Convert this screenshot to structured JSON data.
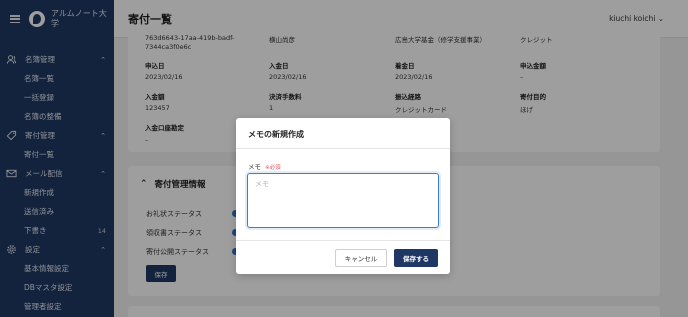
{
  "sidebar": {
    "org_name": "アルムノート大学",
    "items": [
      {
        "label": "名簿管理",
        "section": true,
        "icon": "users-icon",
        "chevron": "^"
      },
      {
        "label": "名簿一覧"
      },
      {
        "label": "一括登録"
      },
      {
        "label": "名簿の整備"
      },
      {
        "label": "寄付管理",
        "section": true,
        "icon": "tag-icon",
        "chevron": "^"
      },
      {
        "label": "寄付一覧"
      },
      {
        "label": "メール配信",
        "section": true,
        "icon": "mail-icon",
        "chevron": "^"
      },
      {
        "label": "新規作成"
      },
      {
        "label": "送信済み"
      },
      {
        "label": "下書き",
        "count": "14"
      },
      {
        "label": "設定",
        "section": true,
        "icon": "gear-icon",
        "chevron": "^"
      },
      {
        "label": "基本情報設定"
      },
      {
        "label": "DBマスタ設定"
      },
      {
        "label": "管理者設定"
      }
    ]
  },
  "header": {
    "title": "寄付一覧",
    "user": "kiuchi koichi"
  },
  "detail": {
    "row0": {
      "id": "763d6643-17aa-419b-badf-7344ca3f0e6c",
      "name": "横山尚彦",
      "fund": "広島大学基金（修学支援事業）",
      "method": "クレジット"
    },
    "row1_labels": {
      "a": "申込日",
      "b": "入金日",
      "c": "着金日",
      "d": "申込金額"
    },
    "row1_values": {
      "a": "2023/02/16",
      "b": "2023/02/16",
      "c": "2023/02/16",
      "d": "–"
    },
    "row2_labels": {
      "a": "入金額",
      "b": "決済手数料",
      "c": "振込経路",
      "d": "寄付目的"
    },
    "row2_values": {
      "a": "123457",
      "b": "1",
      "c": "クレジットカード",
      "d": "ほげ"
    },
    "row3_label": "入金口座勘定",
    "row3_value": "–"
  },
  "donation_mgmt": {
    "title": "寄付管理情報",
    "rows": [
      "お礼状ステータス",
      "領収書ステータス",
      "寄付公開ステータス"
    ],
    "save_label": "保存"
  },
  "modal": {
    "title": "メモの新規作成",
    "field_label": "メモ",
    "required": "※必須",
    "placeholder": "メモ",
    "cancel_label": "キャンセル",
    "save_label": "保存する"
  }
}
